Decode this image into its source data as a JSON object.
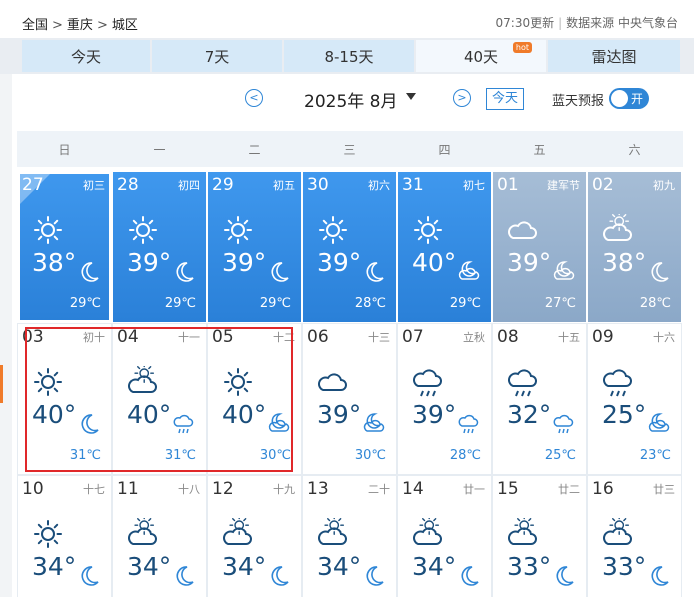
{
  "breadcrumb": {
    "level1": "全国",
    "level2": "重庆",
    "level3": "城区"
  },
  "header": {
    "update_time": "07:30更新",
    "source": "数据来源 中央气象台"
  },
  "tabs": [
    {
      "label": "今天"
    },
    {
      "label": "7天"
    },
    {
      "label": "8-15天"
    },
    {
      "label": "40天",
      "badge": "hot"
    },
    {
      "label": "雷达图"
    }
  ],
  "month_nav": {
    "month": "2025年 8月",
    "today_label": "今天",
    "blue_sky_label": "蓝天预报",
    "toggle_label": "开"
  },
  "weekdays": [
    "日",
    "一",
    "二",
    "三",
    "四",
    "五",
    "六"
  ],
  "days": [
    {
      "date": "27",
      "lunar": "初三",
      "hi": "38°",
      "lo": "29℃",
      "icon": "sunny",
      "icon2": "moon",
      "style": "blue"
    },
    {
      "date": "28",
      "lunar": "初四",
      "hi": "39°",
      "lo": "29℃",
      "icon": "sunny",
      "icon2": "moon",
      "style": "blue"
    },
    {
      "date": "29",
      "lunar": "初五",
      "hi": "39°",
      "lo": "29℃",
      "icon": "sunny",
      "icon2": "moon",
      "style": "blue"
    },
    {
      "date": "30",
      "lunar": "初六",
      "hi": "39°",
      "lo": "28℃",
      "icon": "sunny",
      "icon2": "moon",
      "style": "blue"
    },
    {
      "date": "31",
      "lunar": "初七",
      "hi": "40°",
      "lo": "29℃",
      "icon": "sunny",
      "icon2": "moon-cloud",
      "style": "blue"
    },
    {
      "date": "01",
      "lunar": "建军节",
      "hi": "39°",
      "lo": "27℃",
      "icon": "cloudy",
      "icon2": "moon-cloud",
      "style": "grey"
    },
    {
      "date": "02",
      "lunar": "初九",
      "hi": "38°",
      "lo": "28℃",
      "icon": "partly-cloudy",
      "icon2": "moon",
      "style": "grey"
    },
    {
      "date": "03",
      "lunar": "初十",
      "hi": "40°",
      "lo": "31℃",
      "icon": "sunny",
      "icon2": "moon",
      "style": "white"
    },
    {
      "date": "04",
      "lunar": "十一",
      "hi": "40°",
      "lo": "31℃",
      "icon": "partly-cloudy",
      "icon2": "rain",
      "style": "white"
    },
    {
      "date": "05",
      "lunar": "十二",
      "hi": "40°",
      "lo": "30℃",
      "icon": "sunny",
      "icon2": "moon-cloud",
      "style": "white"
    },
    {
      "date": "06",
      "lunar": "十三",
      "hi": "39°",
      "lo": "30℃",
      "icon": "cloudy",
      "icon2": "moon-cloud",
      "style": "white"
    },
    {
      "date": "07",
      "lunar": "立秋",
      "hi": "39°",
      "lo": "28℃",
      "icon": "rain",
      "icon2": "rain",
      "style": "white"
    },
    {
      "date": "08",
      "lunar": "十五",
      "hi": "32°",
      "lo": "25℃",
      "icon": "rain",
      "icon2": "rain",
      "style": "white"
    },
    {
      "date": "09",
      "lunar": "十六",
      "hi": "25°",
      "lo": "23℃",
      "icon": "rain",
      "icon2": "moon-cloud",
      "style": "white"
    },
    {
      "date": "10",
      "lunar": "十七",
      "hi": "34°",
      "lo": "",
      "icon": "sunny",
      "icon2": "moon",
      "style": "white"
    },
    {
      "date": "11",
      "lunar": "十八",
      "hi": "34°",
      "lo": "",
      "icon": "partly-cloudy",
      "icon2": "moon",
      "style": "white"
    },
    {
      "date": "12",
      "lunar": "十九",
      "hi": "34°",
      "lo": "",
      "icon": "partly-cloudy",
      "icon2": "moon",
      "style": "white"
    },
    {
      "date": "13",
      "lunar": "二十",
      "hi": "34°",
      "lo": "",
      "icon": "partly-cloudy",
      "icon2": "moon",
      "style": "white"
    },
    {
      "date": "14",
      "lunar": "廿一",
      "hi": "34°",
      "lo": "",
      "icon": "partly-cloudy",
      "icon2": "moon",
      "style": "white"
    },
    {
      "date": "15",
      "lunar": "廿二",
      "hi": "33°",
      "lo": "",
      "icon": "partly-cloudy",
      "icon2": "moon",
      "style": "white"
    },
    {
      "date": "16",
      "lunar": "廿三",
      "hi": "33°",
      "lo": "",
      "icon": "partly-cloudy",
      "icon2": "moon",
      "style": "white"
    }
  ]
}
